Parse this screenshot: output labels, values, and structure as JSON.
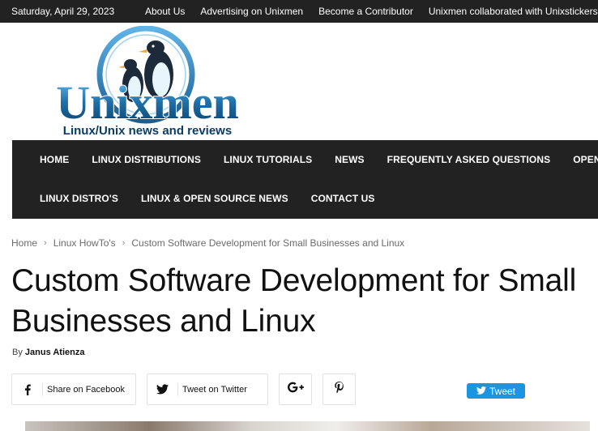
{
  "topbar": {
    "date": "Saturday, April 29, 2023",
    "links": [
      "About Us",
      "Advertising on Unixmen",
      "Become a Contributor",
      "Unixmen collaborated with Unixstickers"
    ]
  },
  "logo": {
    "name": "Unixmen",
    "tagline": "Linux/Unix news and reviews"
  },
  "nav": {
    "row1": [
      "HOME",
      "LINUX DISTRIBUTIONS",
      "LINUX TUTORIALS",
      "NEWS",
      "FREQUENTLY ASKED QUESTIONS",
      "OPENSOURCE"
    ],
    "row2": [
      "LINUX DISTRO'S",
      "LINUX & OPEN SOURCE NEWS",
      "CONTACT US"
    ]
  },
  "breadcrumb": {
    "home": "Home",
    "category": "Linux HowTo's",
    "current": "Custom Software Development for Small Businesses and Linux"
  },
  "article": {
    "title": "Custom Software Development for Small Businesses and Linux",
    "by_label": "By",
    "author": "Janus Atienza"
  },
  "share": {
    "facebook_label": "Share on Facebook",
    "twitter_label": "Tweet on Twitter",
    "tweet_button": "Tweet"
  },
  "colors": {
    "dark_bar": "#222222",
    "accent_blue": "#1b95e0"
  }
}
